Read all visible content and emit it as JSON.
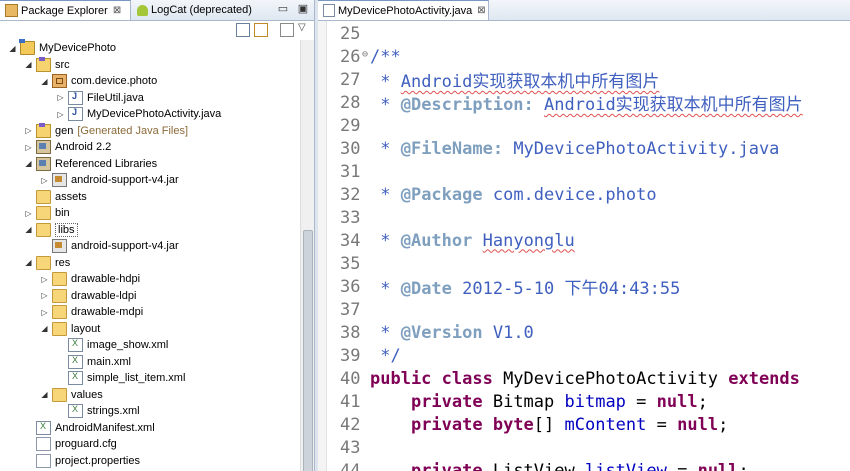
{
  "left_pane": {
    "tabs": [
      {
        "label": "Package Explorer",
        "close": "⊠",
        "active": true
      },
      {
        "label": "LogCat (deprecated)",
        "active": false
      }
    ],
    "tree": [
      {
        "label": "MyDevicePhoto",
        "deco": "",
        "icon": "project-icon",
        "depth": 0,
        "toggle": "◢",
        "selected": false
      },
      {
        "label": "src",
        "deco": "",
        "icon": "source-folder-icon",
        "depth": 1,
        "toggle": "◢",
        "selected": false
      },
      {
        "label": "com.device.photo",
        "deco": "",
        "icon": "package-icon",
        "depth": 2,
        "toggle": "◢",
        "selected": false
      },
      {
        "label": "FileUtil.java",
        "deco": "",
        "icon": "java-file-icon",
        "depth": 3,
        "toggle": "▷",
        "selected": false
      },
      {
        "label": "MyDevicePhotoActivity.java",
        "deco": "",
        "icon": "java-file-icon",
        "depth": 3,
        "toggle": "▷",
        "selected": false
      },
      {
        "label": "gen",
        "deco": "[Generated Java Files]",
        "icon": "source-folder-icon",
        "depth": 1,
        "toggle": "▷",
        "selected": false
      },
      {
        "label": "Android 2.2",
        "deco": "",
        "icon": "library-icon",
        "depth": 1,
        "toggle": "▷",
        "selected": false
      },
      {
        "label": "Referenced Libraries",
        "deco": "",
        "icon": "library-icon",
        "depth": 1,
        "toggle": "◢",
        "selected": false
      },
      {
        "label": "android-support-v4.jar",
        "deco": "",
        "icon": "jar-icon",
        "depth": 2,
        "toggle": "▷",
        "selected": false
      },
      {
        "label": "assets",
        "deco": "",
        "icon": "folder-icon",
        "depth": 1,
        "toggle": "",
        "selected": false
      },
      {
        "label": "bin",
        "deco": "",
        "icon": "folder-icon",
        "depth": 1,
        "toggle": "▷",
        "selected": false
      },
      {
        "label": "libs",
        "deco": "",
        "icon": "folder-icon",
        "depth": 1,
        "toggle": "◢",
        "selected": true
      },
      {
        "label": "android-support-v4.jar",
        "deco": "",
        "icon": "jar-icon",
        "depth": 2,
        "toggle": "",
        "selected": false
      },
      {
        "label": "res",
        "deco": "",
        "icon": "folder-icon",
        "depth": 1,
        "toggle": "◢",
        "selected": false
      },
      {
        "label": "drawable-hdpi",
        "deco": "",
        "icon": "folder-icon",
        "depth": 2,
        "toggle": "▷",
        "selected": false
      },
      {
        "label": "drawable-ldpi",
        "deco": "",
        "icon": "folder-icon",
        "depth": 2,
        "toggle": "▷",
        "selected": false
      },
      {
        "label": "drawable-mdpi",
        "deco": "",
        "icon": "folder-icon",
        "depth": 2,
        "toggle": "▷",
        "selected": false
      },
      {
        "label": "layout",
        "deco": "",
        "icon": "folder-icon",
        "depth": 2,
        "toggle": "◢",
        "selected": false
      },
      {
        "label": "image_show.xml",
        "deco": "",
        "icon": "xml-file-icon",
        "depth": 3,
        "toggle": "",
        "selected": false
      },
      {
        "label": "main.xml",
        "deco": "",
        "icon": "xml-file-icon",
        "depth": 3,
        "toggle": "",
        "selected": false
      },
      {
        "label": "simple_list_item.xml",
        "deco": "",
        "icon": "xml-file-icon",
        "depth": 3,
        "toggle": "",
        "selected": false
      },
      {
        "label": "values",
        "deco": "",
        "icon": "folder-icon",
        "depth": 2,
        "toggle": "◢",
        "selected": false
      },
      {
        "label": "strings.xml",
        "deco": "",
        "icon": "xml-file-icon",
        "depth": 3,
        "toggle": "",
        "selected": false
      },
      {
        "label": "AndroidManifest.xml",
        "deco": "",
        "icon": "xml-file-icon",
        "depth": 1,
        "toggle": "",
        "selected": false
      },
      {
        "label": "proguard.cfg",
        "deco": "",
        "icon": "file-icon",
        "depth": 1,
        "toggle": "",
        "selected": false
      },
      {
        "label": "project.properties",
        "deco": "",
        "icon": "file-icon",
        "depth": 1,
        "toggle": "",
        "selected": false
      }
    ]
  },
  "editor": {
    "tab": {
      "label": "MyDevicePhotoActivity.java",
      "close": "⊠"
    },
    "lines": [
      {
        "num": "25",
        "fold": "",
        "segments": []
      },
      {
        "num": "26",
        "fold": "⊖",
        "segments": [
          {
            "t": "/**",
            "cls": "c"
          }
        ]
      },
      {
        "num": "27",
        "fold": "",
        "segments": [
          {
            "t": " * ",
            "cls": "c"
          },
          {
            "t": "Android实现获取本机中所有图片",
            "cls": "c squig"
          }
        ]
      },
      {
        "num": "28",
        "fold": "",
        "segments": [
          {
            "t": " * ",
            "cls": "c"
          },
          {
            "t": "@Description:",
            "cls": "tag"
          },
          {
            "t": " ",
            "cls": "c"
          },
          {
            "t": "Android实现获取本机中所有图片",
            "cls": "c squig"
          }
        ]
      },
      {
        "num": "29",
        "fold": "",
        "segments": []
      },
      {
        "num": "30",
        "fold": "",
        "segments": [
          {
            "t": " * ",
            "cls": "c"
          },
          {
            "t": "@FileName:",
            "cls": "tag"
          },
          {
            "t": " MyDevicePhotoActivity.java",
            "cls": "c"
          }
        ]
      },
      {
        "num": "31",
        "fold": "",
        "segments": []
      },
      {
        "num": "32",
        "fold": "",
        "segments": [
          {
            "t": " * ",
            "cls": "c"
          },
          {
            "t": "@Package",
            "cls": "tag"
          },
          {
            "t": " com.device.photo",
            "cls": "c"
          }
        ]
      },
      {
        "num": "33",
        "fold": "",
        "segments": []
      },
      {
        "num": "34",
        "fold": "",
        "segments": [
          {
            "t": " * ",
            "cls": "c"
          },
          {
            "t": "@Author",
            "cls": "tag"
          },
          {
            "t": " ",
            "cls": "c"
          },
          {
            "t": "Hanyonglu",
            "cls": "c squig"
          }
        ]
      },
      {
        "num": "35",
        "fold": "",
        "segments": []
      },
      {
        "num": "36",
        "fold": "",
        "segments": [
          {
            "t": " * ",
            "cls": "c"
          },
          {
            "t": "@Date",
            "cls": "tag"
          },
          {
            "t": " 2012-5-10 下午04:43:55",
            "cls": "c"
          }
        ]
      },
      {
        "num": "37",
        "fold": "",
        "segments": []
      },
      {
        "num": "38",
        "fold": "",
        "segments": [
          {
            "t": " * ",
            "cls": "c"
          },
          {
            "t": "@Version",
            "cls": "tag"
          },
          {
            "t": " V1.0",
            "cls": "c"
          }
        ]
      },
      {
        "num": "39",
        "fold": "",
        "segments": [
          {
            "t": " */",
            "cls": "c"
          }
        ]
      },
      {
        "num": "40",
        "fold": "",
        "segments": [
          {
            "t": "public class",
            "cls": "kw"
          },
          {
            "t": " MyDevicePhotoActivity ",
            "cls": "blk"
          },
          {
            "t": "extends",
            "cls": "kw"
          }
        ]
      },
      {
        "num": "41",
        "fold": "",
        "segments": [
          {
            "t": "    ",
            "cls": "blk"
          },
          {
            "t": "private",
            "cls": "kw"
          },
          {
            "t": " Bitmap ",
            "cls": "blk"
          },
          {
            "t": "bitmap",
            "cls": "fld"
          },
          {
            "t": " = ",
            "cls": "blk"
          },
          {
            "t": "null",
            "cls": "kw"
          },
          {
            "t": ";",
            "cls": "blk"
          }
        ]
      },
      {
        "num": "42",
        "fold": "",
        "segments": [
          {
            "t": "    ",
            "cls": "blk"
          },
          {
            "t": "private byte",
            "cls": "kw"
          },
          {
            "t": "[] ",
            "cls": "blk"
          },
          {
            "t": "mContent",
            "cls": "fld"
          },
          {
            "t": " = ",
            "cls": "blk"
          },
          {
            "t": "null",
            "cls": "kw"
          },
          {
            "t": ";",
            "cls": "blk"
          }
        ]
      },
      {
        "num": "43",
        "fold": "",
        "segments": []
      },
      {
        "num": "44",
        "fold": "",
        "segments": [
          {
            "t": "    ",
            "cls": "blk"
          },
          {
            "t": "private",
            "cls": "kw"
          },
          {
            "t": " ListView ",
            "cls": "blk"
          },
          {
            "t": "listView",
            "cls": "fld"
          },
          {
            "t": " = ",
            "cls": "blk"
          },
          {
            "t": "null",
            "cls": "kw"
          },
          {
            "t": ";",
            "cls": "blk"
          }
        ]
      }
    ]
  }
}
